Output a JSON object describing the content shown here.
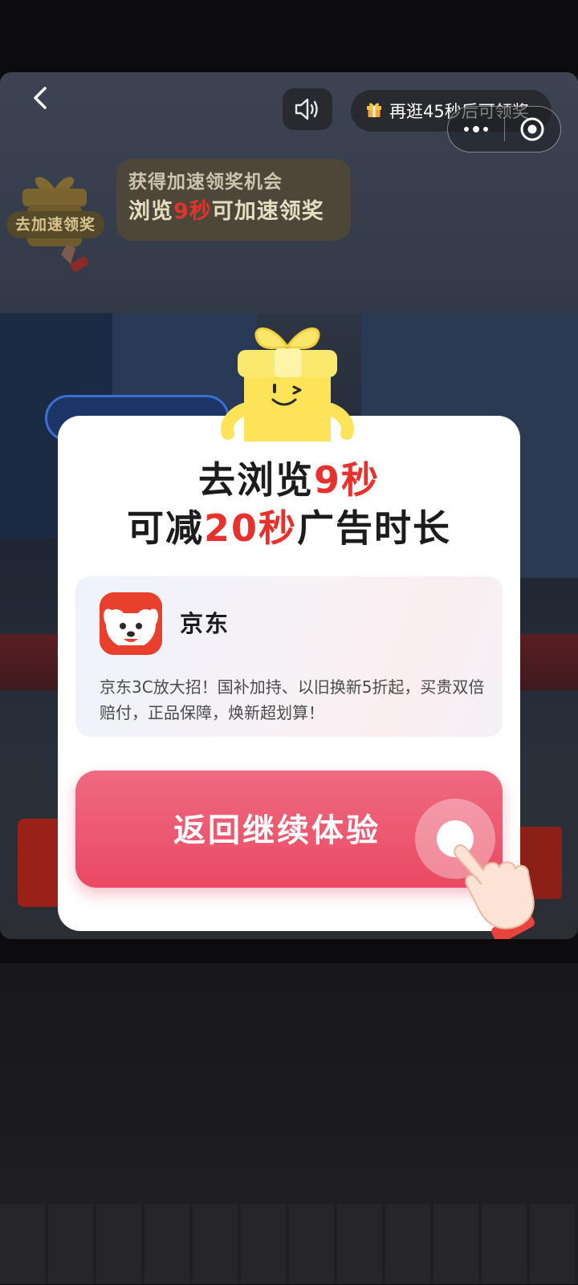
{
  "topbar": {
    "timer_text": "再逛45秒后可领奖",
    "icons": [
      "back-arrow-icon",
      "speaker-icon",
      "gift-icon",
      "more-dots-icon",
      "close-target-icon"
    ]
  },
  "speedup": {
    "badge_label": "去加速领奖",
    "line1": "获得加速领奖机会",
    "line2_prefix": "浏览",
    "line2_highlight": "9秒",
    "line2_suffix": "可加速领奖"
  },
  "dialog": {
    "title_line1_prefix": "去浏览",
    "title_line1_highlight": "9秒",
    "title_line2_prefix": "可减",
    "title_line2_highlight": "20秒",
    "title_line2_suffix": "广告时长",
    "app": {
      "name": "京东",
      "description": "京东3C放大招！国补加持、以旧换新5折起，买贵双倍赔付，正品保障，焕新超划算！"
    },
    "cta_label": "返回继续体验"
  },
  "colors": {
    "highlight_red": "#e8302c",
    "cta_pink": "#ea4a63",
    "jd_red": "#e8402c",
    "dialog_bg": "#ffffff"
  }
}
